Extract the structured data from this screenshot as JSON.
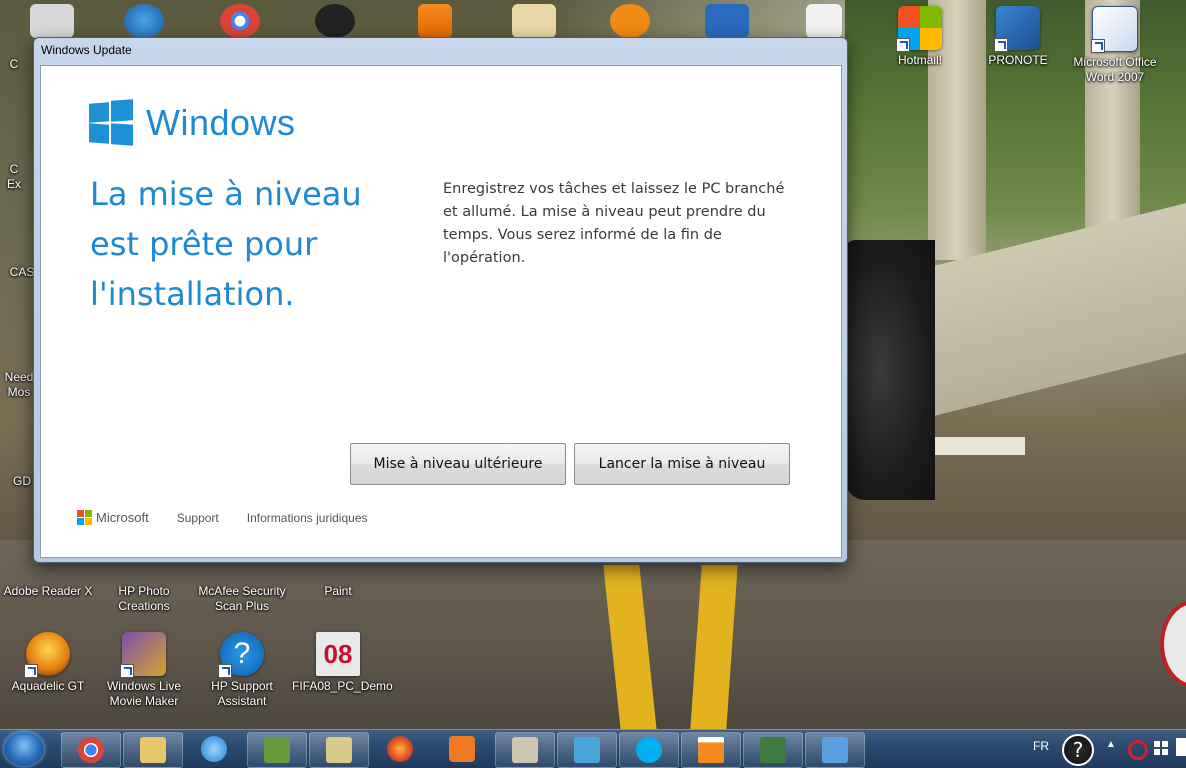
{
  "window": {
    "title": "Windows Update",
    "brand": "Windows",
    "headline": "La mise à niveau est prête pour l'installation.",
    "description": "Enregistrez vos tâches et laissez le PC branché et allumé. La mise à niveau peut prendre du temps. Vous serez informé de la fin de l'opération.",
    "buttons": {
      "later": "Mise à niveau ultérieure",
      "start": "Lancer la mise à niveau"
    },
    "footer": {
      "microsoft": "Microsoft",
      "support": "Support",
      "legal": "Informations juridiques"
    },
    "colors": {
      "accent": "#1e88d2"
    }
  },
  "desktop": {
    "icons_right": [
      {
        "label": "Hotmail!",
        "icon": "windows-live-icon"
      },
      {
        "label": "PRONOTE",
        "icon": "pronote-icon"
      },
      {
        "label": "Microsoft Office Word 2007",
        "icon": "word-icon"
      }
    ],
    "icons_left_partial": [
      {
        "label": "C",
        "icon": "recycle-bin-icon"
      },
      {
        "label": "C",
        "icon": "shortcut-icon"
      },
      {
        "label": "Ex",
        "icon": "shortcut-icon"
      },
      {
        "label": "CAS",
        "icon": "shortcut-icon"
      },
      {
        "label": "Need",
        "icon": "shortcut-icon"
      },
      {
        "label": "Mos",
        "icon": "shortcut-icon"
      },
      {
        "label": "GD",
        "icon": "shortcut-icon"
      }
    ],
    "icons_row1": [
      {
        "label": "Adobe Reader X",
        "icon": "adobe-reader-icon"
      },
      {
        "label": "HP Photo Creations",
        "icon": "hp-photo-icon"
      },
      {
        "label": "McAfee Security Scan Plus",
        "icon": "mcafee-icon"
      },
      {
        "label": "Paint",
        "icon": "paint-icon"
      }
    ],
    "icons_row2": [
      {
        "label": "Aquadelic GT",
        "icon": "aquadelic-icon"
      },
      {
        "label": "Windows Live Movie Maker",
        "icon": "movie-maker-icon"
      },
      {
        "label": "HP Support Assistant",
        "icon": "help-icon"
      },
      {
        "label": "FIFA08_PC_Demo",
        "icon": "fifa-icon",
        "badge": "08"
      }
    ]
  },
  "taskbar": {
    "language": "FR",
    "pinned": [
      "chrome-icon",
      "explorer-icon",
      "internet-explorer-icon",
      "hp-icon",
      "photos-icon",
      "firefox-icon",
      "media-player-icon",
      "network-icon",
      "fish-icon",
      "skype-icon",
      "vlc-icon",
      "monitor-icon",
      "windows-update-icon"
    ]
  }
}
